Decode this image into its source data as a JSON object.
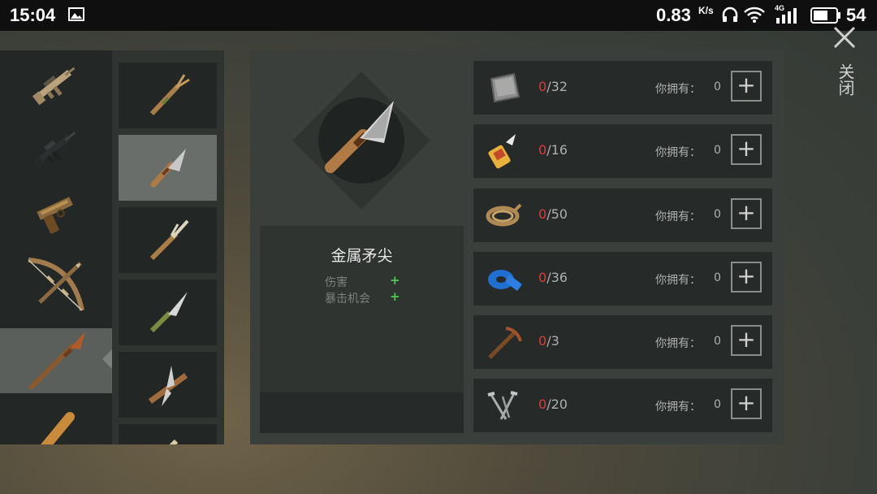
{
  "status_bar": {
    "time": "15:04",
    "speed": "0.83",
    "speed_unit": "K/s",
    "network": "4G",
    "battery": "54"
  },
  "categories": [
    {
      "icon": "assault-rifle-icon"
    },
    {
      "icon": "m16-rifle-icon"
    },
    {
      "icon": "pistol-icon"
    },
    {
      "icon": "crossbow-icon"
    },
    {
      "icon": "spear-icon",
      "selected": true
    },
    {
      "icon": "bat-icon"
    }
  ],
  "sub_items": [
    {
      "icon": "wooden-spear-tip-icon"
    },
    {
      "icon": "metal-spear-tip-icon",
      "selected": true
    },
    {
      "icon": "bone-spear-tip-icon"
    },
    {
      "icon": "knife-spear-tip-icon"
    },
    {
      "icon": "blade-spear-tip-icon"
    },
    {
      "icon": "spear-tip-icon"
    }
  ],
  "selected_item": {
    "name": "金属矛尖",
    "stats": [
      {
        "label": "伤害",
        "indicator": "+"
      },
      {
        "label": "暴击机会",
        "indicator": "+"
      }
    ]
  },
  "requirements": [
    {
      "icon": "metal-plate-icon",
      "current": "0",
      "required": "/32",
      "own_label": "你拥有：",
      "own_value": "0"
    },
    {
      "icon": "glue-icon",
      "current": "0",
      "required": "/16",
      "own_label": "你拥有：",
      "own_value": "0"
    },
    {
      "icon": "rope-icon",
      "current": "0",
      "required": "/50",
      "own_label": "你拥有：",
      "own_value": "0"
    },
    {
      "icon": "tape-icon",
      "current": "0",
      "required": "/36",
      "own_label": "你拥有：",
      "own_value": "0"
    },
    {
      "icon": "pickaxe-icon",
      "current": "0",
      "required": "/3",
      "own_label": "你拥有：",
      "own_value": "0"
    },
    {
      "icon": "nails-icon",
      "current": "0",
      "required": "/20",
      "own_label": "你拥有：",
      "own_value": "0"
    }
  ],
  "add_label": "+",
  "close_label": "关闭",
  "colors": {
    "missing": "#e03a32",
    "positive": "#55c55a",
    "row_bg": "#262b29",
    "panel_bg": "#3a3f3b"
  }
}
